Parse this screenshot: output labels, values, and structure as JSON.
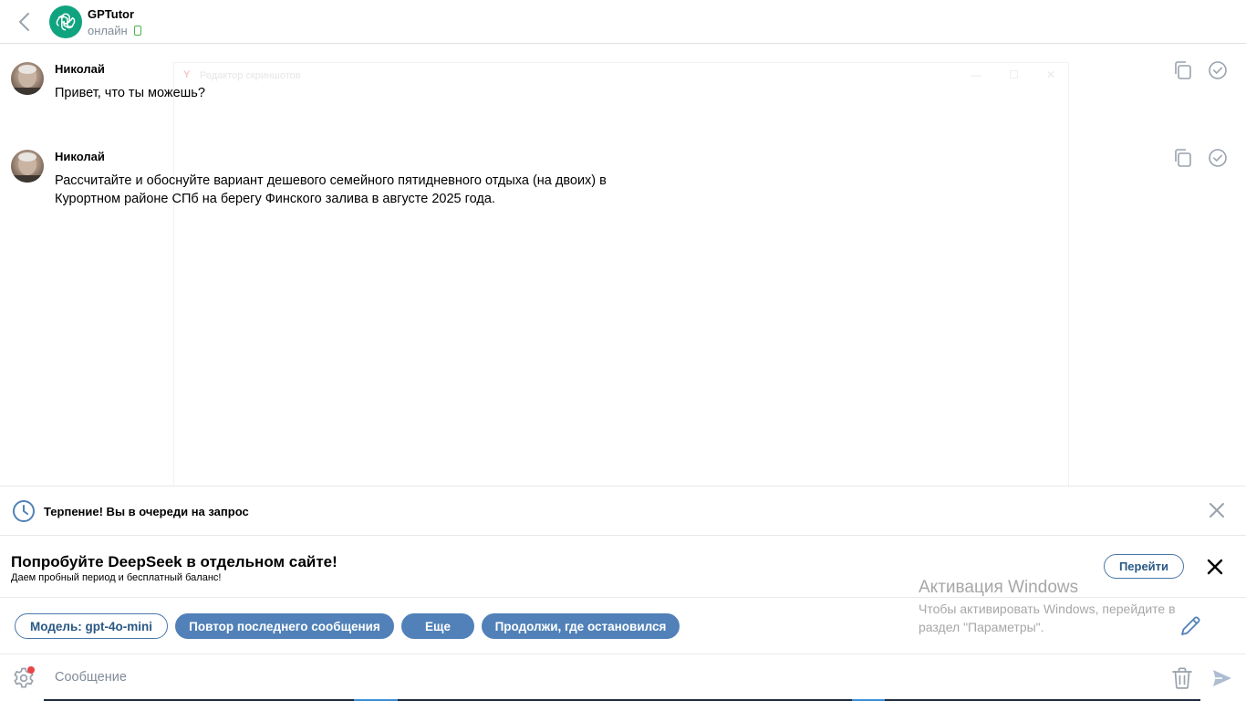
{
  "header": {
    "title": "GPTutor",
    "status": "онлайн"
  },
  "messages": [
    {
      "author": "Николай",
      "text": "Привет, что ты можешь?"
    },
    {
      "author": "Николай",
      "text": "Рассчитайте и обоснуйте вариант дешевого семейного пятидневного отдыха (на двоих) в Курортном районе СПб на берегу Финского залива в августе 2025 года."
    }
  ],
  "overlay": {
    "title": "Редактор скриншотов"
  },
  "queue": {
    "text": "Терпение! Вы в очереди на запрос"
  },
  "promo": {
    "title": "Попробуйте DeepSeek в отдельном сайте!",
    "subtitle": "Даем пробный период и бесплатный баланс!",
    "button_label": "Перейти"
  },
  "watermark": {
    "title": "Активация Windows",
    "text": "Чтобы активировать Windows, перейдите в раздел \"Параметры\"."
  },
  "chips": {
    "model": "Модель: gpt-4o-mini",
    "repeat": "Повтор последнего сообщения",
    "more": "Еще",
    "continue": "Продолжи, где остановился"
  },
  "input": {
    "placeholder": "Сообщение",
    "value": ""
  },
  "colors": {
    "accent": "#5181b8",
    "accent_text": "#2a5885",
    "online": "#4bb34b",
    "brand_avatar": "#10a37f",
    "icon_gray": "#99a2ad",
    "notification_dot": "#e64646"
  },
  "icons": {
    "back": "chevron-left-icon",
    "brand": "openai-logo-icon",
    "copy": "copy-icon",
    "select": "check-circle-icon",
    "queue": "clock-icon",
    "close": "close-icon",
    "edit": "pencil-icon",
    "settings": "gear-icon",
    "trash": "trash-icon",
    "send": "send-icon"
  }
}
